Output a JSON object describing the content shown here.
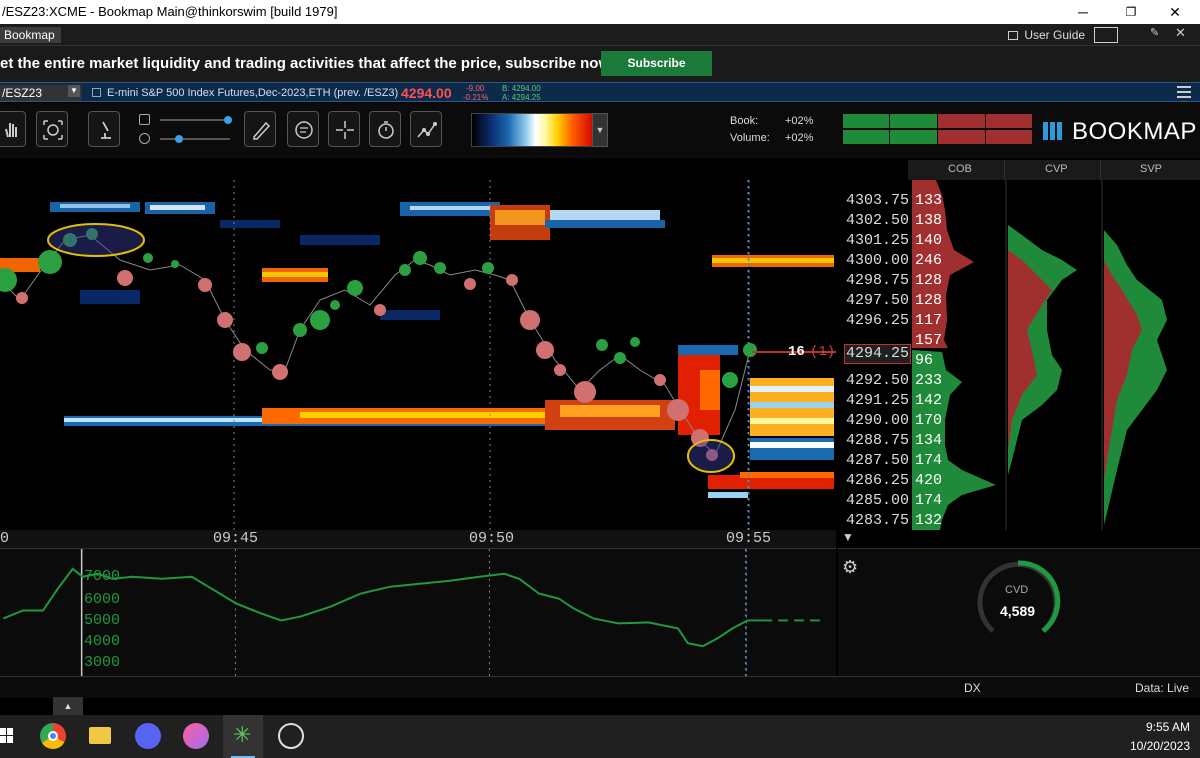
{
  "window": {
    "title": "/ESZ23:XCME - Bookmap Main@thinkorswim [build 1979]",
    "minimize": "─",
    "restore": "❐",
    "close": "✕"
  },
  "menu": {
    "app_tab": "Bookmap",
    "user_guide": "User Guide"
  },
  "promo": {
    "text": "et the entire market liquidity and trading activities that affect the price, subscribe now!",
    "button": "Subscribe"
  },
  "instrument": {
    "symbol": "/ESZ23",
    "description": "E-mini S&P 500 Index Futures,Dec-2023,ETH (prev. /ESZ3)",
    "last_price": "4294.00",
    "change": "-9.00",
    "change_pct": "-0.21%",
    "bid": "B: 4294.00",
    "ask": "A: 4294.25"
  },
  "stats": {
    "book_label": "Book:",
    "book_value": "+02%",
    "volume_label": "Volume:",
    "volume_value": "+02%"
  },
  "logo": "BOOKMAP",
  "right_headers": [
    "COB",
    "CVP",
    "SVP"
  ],
  "price_levels": [
    {
      "price": "4303.75",
      "size": "133"
    },
    {
      "price": "4302.50",
      "size": "138"
    },
    {
      "price": "4301.25",
      "size": "140"
    },
    {
      "price": "4300.00",
      "size": "246"
    },
    {
      "price": "4298.75",
      "size": "128"
    },
    {
      "price": "4297.50",
      "size": "128"
    },
    {
      "price": "4296.25",
      "size": "117"
    },
    {
      "price": "",
      "size": "157"
    },
    {
      "price": "4294.25",
      "size": "96"
    },
    {
      "price": "4292.50",
      "size": "233"
    },
    {
      "price": "4291.25",
      "size": "142"
    },
    {
      "price": "4290.00",
      "size": "170"
    },
    {
      "price": "4288.75",
      "size": "134"
    },
    {
      "price": "4287.50",
      "size": "174"
    },
    {
      "price": "4286.25",
      "size": "420"
    },
    {
      "price": "4285.00",
      "size": "174"
    },
    {
      "price": "4283.75",
      "size": "132"
    }
  ],
  "trade_marker": {
    "size": "16",
    "count": "(1)"
  },
  "time_axis": [
    "0",
    "09:45",
    "09:50",
    "09:55"
  ],
  "indicator_axis": [
    "7000",
    "6000",
    "5000",
    "4000",
    "3000"
  ],
  "cvd": {
    "label": "CVD",
    "value": "4,589"
  },
  "status": {
    "dx": "DX",
    "data": "Data: Live"
  },
  "expand_btn": "▲",
  "clock": {
    "time": "9:55 AM",
    "date": "10/20/2023"
  },
  "colors": {
    "ask": "#a03030",
    "bid": "#1f8a3a",
    "accent": "#2a9ad8",
    "subscribe": "#1a7a3a"
  }
}
